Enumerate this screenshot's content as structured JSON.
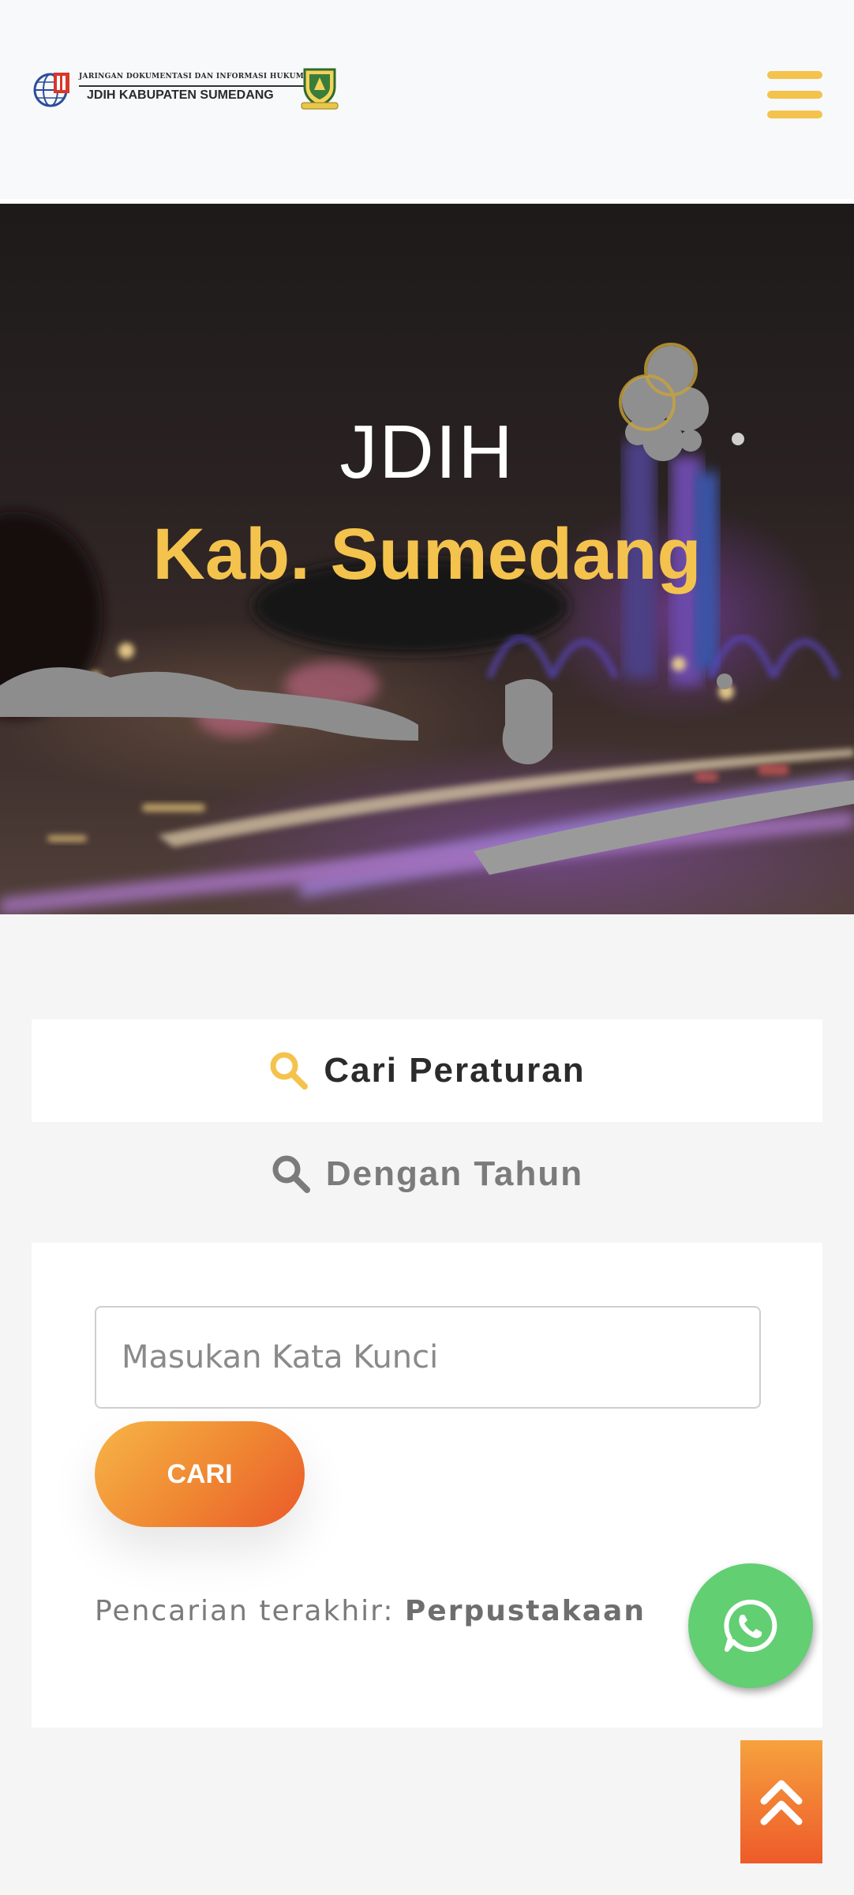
{
  "header": {
    "logo_line1": "JARINGAN DOKUMENTASI DAN INFORMASI HUKUM",
    "logo_line2": "JDIH KABUPATEN SUMEDANG",
    "menu_icon": "hamburger-menu-icon"
  },
  "hero": {
    "title": "JDIH",
    "subtitle": "Kab. Sumedang"
  },
  "tabs": [
    {
      "label": "Cari Peraturan",
      "icon": "search-icon",
      "active": true
    },
    {
      "label": "Dengan Tahun",
      "icon": "search-icon",
      "active": false
    }
  ],
  "search": {
    "placeholder": "Masukan Kata Kunci",
    "value": "",
    "button_label": "CARI",
    "recent_label": "Pencarian terakhir:",
    "recent_term": "Perpustakaan"
  },
  "floating": {
    "whatsapp_icon": "whatsapp-icon",
    "scroll_top_icon": "double-chevron-up-icon"
  },
  "colors": {
    "accent": "#f4c34d",
    "button_gradient_start": "#f7b548",
    "button_gradient_end": "#ea5a29",
    "whatsapp": "#62cf72"
  }
}
